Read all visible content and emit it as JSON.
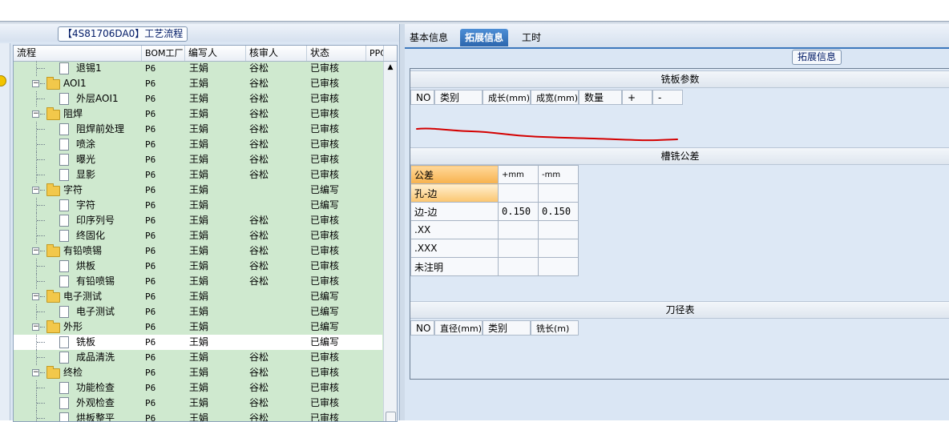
{
  "left_panel": {
    "title": "【4S81706DA0】工艺流程",
    "columns": [
      "流程",
      "BOM工厂",
      "编写人",
      "核审人",
      "状态",
      "PPC"
    ],
    "rows": [
      {
        "level": 1,
        "type": "doc",
        "name": "退锡1",
        "factory": "P6",
        "writer": "王娟",
        "reviewer": "谷松",
        "status": "已审核",
        "selected": false
      },
      {
        "level": 0,
        "type": "folder",
        "name": "AOI1",
        "factory": "P6",
        "writer": "王娟",
        "reviewer": "谷松",
        "status": "已审核",
        "selected": false
      },
      {
        "level": 1,
        "type": "doc",
        "name": "外层AOI1",
        "factory": "P6",
        "writer": "王娟",
        "reviewer": "谷松",
        "status": "已审核",
        "selected": false
      },
      {
        "level": 0,
        "type": "folder",
        "name": "阻焊",
        "factory": "P6",
        "writer": "王娟",
        "reviewer": "谷松",
        "status": "已审核",
        "selected": false
      },
      {
        "level": 1,
        "type": "doc",
        "name": "阻焊前处理",
        "factory": "P6",
        "writer": "王娟",
        "reviewer": "谷松",
        "status": "已审核",
        "selected": false
      },
      {
        "level": 1,
        "type": "doc",
        "name": "喷涂",
        "factory": "P6",
        "writer": "王娟",
        "reviewer": "谷松",
        "status": "已审核",
        "selected": false
      },
      {
        "level": 1,
        "type": "doc",
        "name": "曝光",
        "factory": "P6",
        "writer": "王娟",
        "reviewer": "谷松",
        "status": "已审核",
        "selected": false
      },
      {
        "level": 1,
        "type": "doc",
        "name": "显影",
        "factory": "P6",
        "writer": "王娟",
        "reviewer": "谷松",
        "status": "已审核",
        "selected": false
      },
      {
        "level": 0,
        "type": "folder",
        "name": "字符",
        "factory": "P6",
        "writer": "王娟",
        "reviewer": "",
        "status": "已编写",
        "selected": false
      },
      {
        "level": 1,
        "type": "doc",
        "name": "字符",
        "factory": "P6",
        "writer": "王娟",
        "reviewer": "",
        "status": "已编写",
        "selected": false
      },
      {
        "level": 1,
        "type": "doc",
        "name": "印序列号",
        "factory": "P6",
        "writer": "王娟",
        "reviewer": "谷松",
        "status": "已审核",
        "selected": false
      },
      {
        "level": 1,
        "type": "doc",
        "name": "终固化",
        "factory": "P6",
        "writer": "王娟",
        "reviewer": "谷松",
        "status": "已审核",
        "selected": false
      },
      {
        "level": 0,
        "type": "folder",
        "name": "有铅喷锡",
        "factory": "P6",
        "writer": "王娟",
        "reviewer": "谷松",
        "status": "已审核",
        "selected": false
      },
      {
        "level": 1,
        "type": "doc",
        "name": "烘板",
        "factory": "P6",
        "writer": "王娟",
        "reviewer": "谷松",
        "status": "已审核",
        "selected": false
      },
      {
        "level": 1,
        "type": "doc",
        "name": "有铅喷锡",
        "factory": "P6",
        "writer": "王娟",
        "reviewer": "谷松",
        "status": "已审核",
        "selected": false
      },
      {
        "level": 0,
        "type": "folder",
        "name": "电子测试",
        "factory": "P6",
        "writer": "王娟",
        "reviewer": "",
        "status": "已编写",
        "selected": false
      },
      {
        "level": 1,
        "type": "doc",
        "name": "电子测试",
        "factory": "P6",
        "writer": "王娟",
        "reviewer": "",
        "status": "已编写",
        "selected": false
      },
      {
        "level": 0,
        "type": "folder",
        "name": "外形",
        "factory": "P6",
        "writer": "王娟",
        "reviewer": "",
        "status": "已编写",
        "selected": false
      },
      {
        "level": 1,
        "type": "doc",
        "name": "铣板",
        "factory": "P6",
        "writer": "王娟",
        "reviewer": "",
        "status": "已编写",
        "selected": true
      },
      {
        "level": 1,
        "type": "doc",
        "name": "成品清洗",
        "factory": "P6",
        "writer": "王娟",
        "reviewer": "谷松",
        "status": "已审核",
        "selected": false
      },
      {
        "level": 0,
        "type": "folder",
        "name": "终检",
        "factory": "P6",
        "writer": "王娟",
        "reviewer": "谷松",
        "status": "已审核",
        "selected": false
      },
      {
        "level": 1,
        "type": "doc",
        "name": "功能检查",
        "factory": "P6",
        "writer": "王娟",
        "reviewer": "谷松",
        "status": "已审核",
        "selected": false
      },
      {
        "level": 1,
        "type": "doc",
        "name": "外观检查",
        "factory": "P6",
        "writer": "王娟",
        "reviewer": "谷松",
        "status": "已审核",
        "selected": false
      },
      {
        "level": 1,
        "type": "doc",
        "name": "烘板整平",
        "factory": "P6",
        "writer": "王娟",
        "reviewer": "谷松",
        "status": "已审核",
        "selected": false
      }
    ]
  },
  "right_panel": {
    "tabs": [
      {
        "label": "基本信息",
        "active": false
      },
      {
        "label": "拓展信息",
        "active": true
      },
      {
        "label": "工时",
        "active": false
      }
    ],
    "group_title": "拓展信息",
    "milling_params": {
      "title": "铣板参数",
      "columns": [
        "NO",
        "类别",
        "成长(mm)",
        "成宽(mm)",
        "数量",
        "+",
        "-"
      ]
    },
    "slot_tolerance": {
      "title": "槽铣公差",
      "header": [
        "公差",
        "+mm",
        "-mm"
      ],
      "rows": [
        {
          "label": "孔-边",
          "plus": "",
          "minus": ""
        },
        {
          "label": "边-边",
          "plus": "0.150",
          "minus": "0.150"
        },
        {
          "label": ".XX",
          "plus": "",
          "minus": ""
        },
        {
          "label": ".XXX",
          "plus": "",
          "minus": ""
        },
        {
          "label": "未注明",
          "plus": "",
          "minus": ""
        }
      ]
    },
    "tool_table": {
      "title": "刀径表",
      "columns": [
        "NO",
        "直径(mm)",
        "类别",
        "铣长(m)"
      ]
    }
  },
  "colors": {
    "tree_bg": "#cfe9cf",
    "active_tab": "#3a7bc8",
    "highlight_orange": "#f7b24e",
    "annotation_red": "#d40000"
  }
}
